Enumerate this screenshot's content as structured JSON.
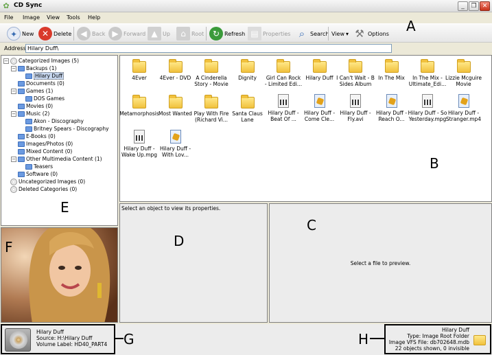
{
  "window": {
    "title": "CD Sync"
  },
  "menu": [
    "File",
    "Image",
    "View",
    "Tools",
    "Help"
  ],
  "toolbar": {
    "new": "New",
    "delete": "Delete",
    "back": "Back",
    "forward": "Forward",
    "up": "Up",
    "root": "Root",
    "refresh": "Refresh",
    "properties": "Properties",
    "search": "Search",
    "view": "View",
    "options": "Options"
  },
  "address": {
    "label": "Address",
    "value": "Hilary Duff\\"
  },
  "tree": [
    {
      "label": "Categorized Images (5)"
    },
    {
      "label": "Backups (1)"
    },
    {
      "label": "Hilary Duff"
    },
    {
      "label": "Documents (0)"
    },
    {
      "label": "Games (1)"
    },
    {
      "label": "DOS Games"
    },
    {
      "label": "Movies (0)"
    },
    {
      "label": "Music (2)"
    },
    {
      "label": "Akon - Discography"
    },
    {
      "label": "Britney Spears - Discography"
    },
    {
      "label": "E-Books (0)"
    },
    {
      "label": "Images/Photos (0)"
    },
    {
      "label": "Mixed Content (0)"
    },
    {
      "label": "Other Multimedia Content (1)"
    },
    {
      "label": "Teasers"
    },
    {
      "label": "Software (0)"
    },
    {
      "label": "Uncategorized Images (0)"
    },
    {
      "label": "Deleted Categories (0)"
    }
  ],
  "files": [
    {
      "name": "4Ever",
      "name2": "",
      "kind": "folder"
    },
    {
      "name": "4Ever - DVD",
      "name2": "",
      "kind": "folder"
    },
    {
      "name": "A Cinderella",
      "name2": "Story - Movie",
      "kind": "folder"
    },
    {
      "name": "Dignity",
      "name2": "",
      "kind": "folder"
    },
    {
      "name": "Girl Can Rock",
      "name2": "- Limited Edi...",
      "kind": "folder"
    },
    {
      "name": "Hilary Duff",
      "name2": "",
      "kind": "folder"
    },
    {
      "name": "I Can't Wait - B",
      "name2": "Sides Album",
      "kind": "folder"
    },
    {
      "name": "In The Mix",
      "name2": "",
      "kind": "folder"
    },
    {
      "name": "In The Mix -",
      "name2": "Ultimate_Edi...",
      "kind": "folder"
    },
    {
      "name": "Lizzie Mcguire",
      "name2": "Movie",
      "kind": "folder"
    },
    {
      "name": "Metamorphosis",
      "name2": "",
      "kind": "folder"
    },
    {
      "name": "Most Wanted",
      "name2": "",
      "kind": "folder"
    },
    {
      "name": "Play With Fire",
      "name2": "(Richard Vi...",
      "kind": "folder"
    },
    {
      "name": "Santa Claus",
      "name2": "Lane",
      "kind": "folder"
    },
    {
      "name": "Hilary Duff -",
      "name2": "Beat Of ...",
      "kind": "video"
    },
    {
      "name": "Hilary Duff -",
      "name2": "Come Cle...",
      "kind": "media"
    },
    {
      "name": "Hilary Duff -",
      "name2": "Fly.avi",
      "kind": "video"
    },
    {
      "name": "Hilary Duff -",
      "name2": "Reach O...",
      "kind": "media"
    },
    {
      "name": "Hilary Duff - So",
      "name2": "Yesterday.mpg",
      "kind": "video"
    },
    {
      "name": "Hilary Duff -",
      "name2": "Stranger.mp4",
      "kind": "media"
    },
    {
      "name": "Hilary Duff -",
      "name2": "Wake Up.mpg",
      "kind": "video"
    },
    {
      "name": "Hilary Duff -",
      "name2": "With Lov...",
      "kind": "media"
    }
  ],
  "properties_hint": "Select an object to view its properties.",
  "preview_hint": "Select a file to preview.",
  "status_left": {
    "name": "Hilary Duff",
    "source": "Source: H:\\Hilary Duff",
    "volume": "Volume Label: HD40_PART4"
  },
  "status_right": {
    "name": "Hilary Duff",
    "type": "Type: Image Root Folder",
    "vfs": "Image VFS File: db702648.mdb",
    "count": "22 objects shown, 0 invisible"
  },
  "annotations": {
    "A": "A",
    "B": "B",
    "C": "C",
    "D": "D",
    "E": "E",
    "F": "F",
    "G": "G",
    "H": "H"
  }
}
